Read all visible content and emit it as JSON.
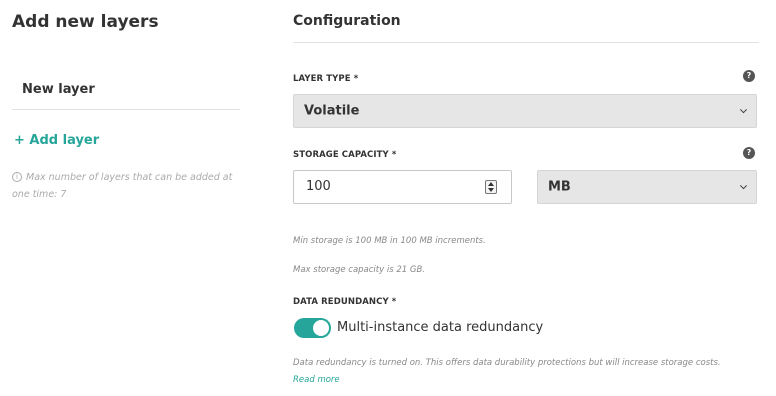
{
  "left_panel": {
    "title": "Add new layers",
    "layer_name": "New layer",
    "add_layer_label": "+ Add layer",
    "info_glyph": "i",
    "max_note": "Max number of layers that can be added at one time: 7"
  },
  "config": {
    "title": "Configuration",
    "help_glyph": "?",
    "layer_type": {
      "label": "LAYER TYPE *",
      "selected": "Volatile"
    },
    "storage_capacity": {
      "label": "STORAGE CAPACITY *",
      "value": "100",
      "unit_selected": "MB"
    },
    "hints": {
      "min_storage": "Min storage is 100 MB in 100 MB increments.",
      "max_storage": "Max storage capacity is 21 GB."
    },
    "data_redundancy": {
      "label": "DATA REDUNDANCY *",
      "toggle_label": "Multi-instance data redundancy",
      "toggle_on": true,
      "note": "Data redundancy is turned on. This offers data durability protections but will increase storage costs.",
      "read_more": "Read more"
    }
  },
  "colors": {
    "accent": "#26a69a",
    "select_bg": "#e6e6e6",
    "help_icon": "#555555"
  }
}
